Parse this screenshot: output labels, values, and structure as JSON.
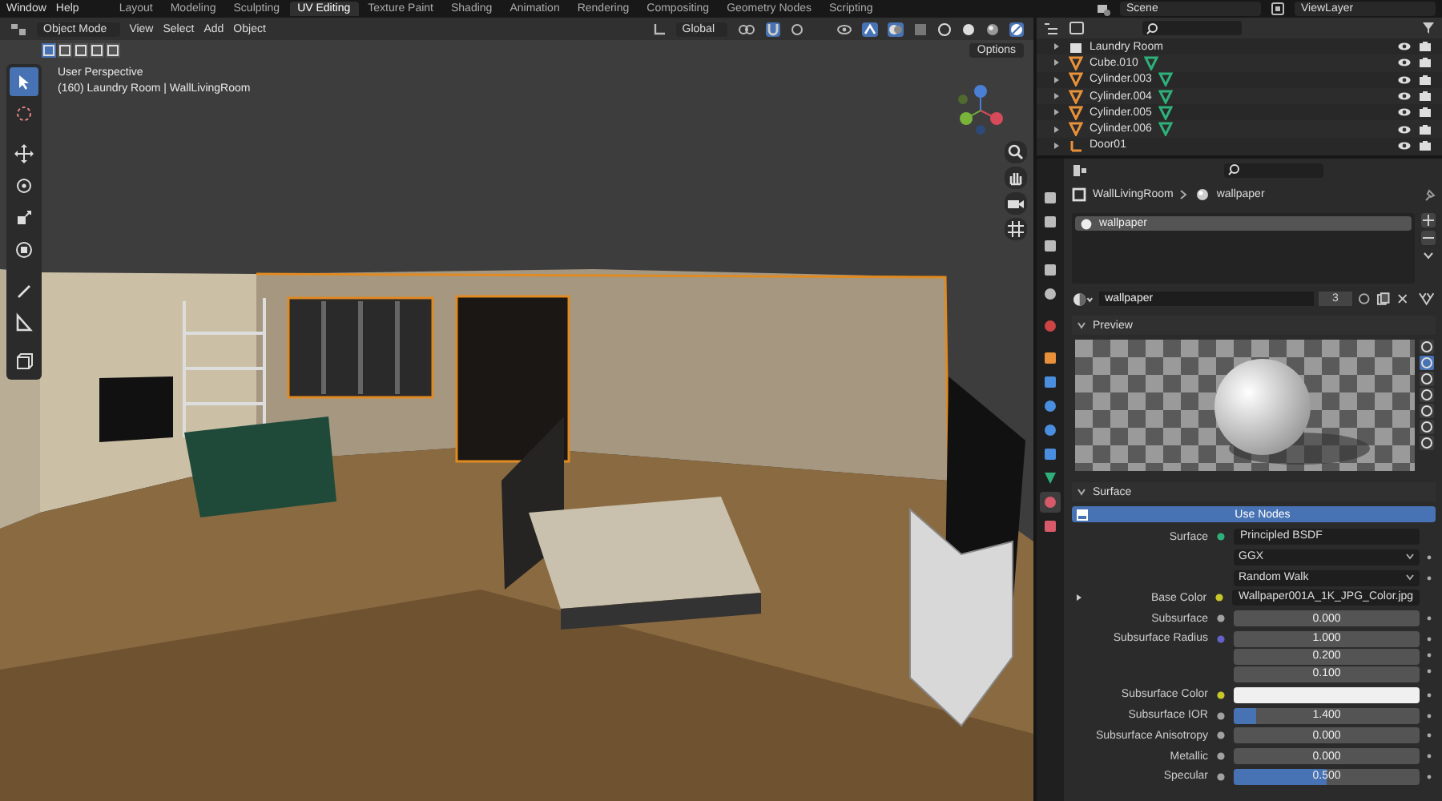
{
  "topbar": {
    "menus": [
      "Window",
      "Help"
    ],
    "workspaces": [
      {
        "label": "Layout",
        "selected": false
      },
      {
        "label": "Modeling",
        "selected": false
      },
      {
        "label": "Sculpting",
        "selected": false
      },
      {
        "label": "UV Editing",
        "selected": true
      },
      {
        "label": "Texture Paint",
        "selected": false
      },
      {
        "label": "Shading",
        "selected": false
      },
      {
        "label": "Animation",
        "selected": false
      },
      {
        "label": "Rendering",
        "selected": false
      },
      {
        "label": "Compositing",
        "selected": false
      },
      {
        "label": "Geometry Nodes",
        "selected": false
      },
      {
        "label": "Scripting",
        "selected": false
      }
    ],
    "scene": "Scene",
    "view_layer": "ViewLayer"
  },
  "viewport": {
    "mode": "Object Mode",
    "menus": [
      "View",
      "Select",
      "Add",
      "Object"
    ],
    "orientation": "Global",
    "select_modes": [
      {
        "selected": true
      },
      {
        "selected": false
      },
      {
        "selected": false
      },
      {
        "selected": false
      },
      {
        "selected": false
      }
    ],
    "view_name": "User Perspective",
    "context": "(160) Laundry Room | WallLivingRoom",
    "options": "Options",
    "tools": [
      {
        "kind": "select",
        "selected": true
      },
      {
        "kind": "cursor",
        "selected": false
      },
      {
        "kind": "move",
        "selected": false
      },
      {
        "kind": "rotate",
        "selected": false
      },
      {
        "kind": "scale",
        "selected": false
      },
      {
        "kind": "transform",
        "selected": false
      },
      {
        "kind": "annotate",
        "selected": false
      },
      {
        "kind": "measure",
        "selected": false
      },
      {
        "kind": "add",
        "selected": false
      }
    ]
  },
  "outliner": {
    "items": [
      {
        "name": "Laundry Room",
        "kind": "collection"
      },
      {
        "name": "Cube.010",
        "kind": "mesh"
      },
      {
        "name": "Cylinder.003",
        "kind": "mesh"
      },
      {
        "name": "Cylinder.004",
        "kind": "mesh"
      },
      {
        "name": "Cylinder.005",
        "kind": "mesh"
      },
      {
        "name": "Cylinder.006",
        "kind": "mesh"
      },
      {
        "name": "Door01",
        "kind": "empty"
      }
    ]
  },
  "properties": {
    "tabs": [
      {
        "kind": "tool",
        "selected": false
      },
      {
        "kind": "render",
        "selected": false
      },
      {
        "kind": "output",
        "selected": false
      },
      {
        "kind": "view",
        "selected": false
      },
      {
        "kind": "scene",
        "selected": false
      },
      {
        "kind": "world",
        "selected": false
      },
      {
        "kind": "object",
        "selected": false
      },
      {
        "kind": "modifier",
        "selected": false
      },
      {
        "kind": "particles",
        "selected": false
      },
      {
        "kind": "physics",
        "selected": false
      },
      {
        "kind": "constraint",
        "selected": false
      },
      {
        "kind": "data",
        "selected": false
      },
      {
        "kind": "material",
        "selected": true
      },
      {
        "kind": "texture",
        "selected": false
      }
    ],
    "breadcrumb": [
      "WallLivingRoom",
      "wallpaper"
    ],
    "slots": [
      {
        "name": "wallpaper",
        "selected": true
      }
    ],
    "material": {
      "name": "wallpaper",
      "users": "3"
    },
    "preview_title": "Preview",
    "preview_shapes": [
      {
        "selected": false
      },
      {
        "selected": true
      },
      {
        "selected": false
      },
      {
        "selected": false
      },
      {
        "selected": false
      },
      {
        "selected": false
      },
      {
        "selected": false
      }
    ],
    "surface_title": "Surface",
    "use_nodes": "Use Nodes",
    "fields": [
      {
        "kind": "link",
        "label": "Surface",
        "color": "#2fb07a",
        "value": "Principled BSDF"
      },
      {
        "kind": "dropdown",
        "value": "GGX"
      },
      {
        "kind": "dropdown",
        "value": "Random Walk"
      },
      {
        "kind": "link",
        "label": "Base Color",
        "color": "#c7c729",
        "value": "Wallpaper001A_1K_JPG_Color.jpg",
        "expandable": true
      },
      {
        "kind": "number",
        "label": "Subsurface",
        "color": "#a1a1a1",
        "value": "0.000",
        "level": 0
      },
      {
        "kind": "vector",
        "label": "Subsurface Radius",
        "color": "#6363c7",
        "values": [
          "1.000",
          "0.200",
          "0.100"
        ]
      },
      {
        "kind": "color",
        "label": "Subsurface Color",
        "color": "#c7c729",
        "swatch": {
          "color": "#f0f0f0"
        }
      },
      {
        "kind": "number",
        "label": "Subsurface IOR",
        "color": "#a1a1a1",
        "value": "1.400",
        "level": 0.12
      },
      {
        "kind": "number",
        "label": "Subsurface Anisotropy",
        "color": "#a1a1a1",
        "value": "0.000",
        "level": 0
      },
      {
        "kind": "number",
        "label": "Metallic",
        "color": "#a1a1a1",
        "value": "0.000",
        "level": 0
      },
      {
        "kind": "number",
        "label": "Specular",
        "color": "#a1a1a1",
        "value": "0.500",
        "level": 0.5
      }
    ]
  }
}
